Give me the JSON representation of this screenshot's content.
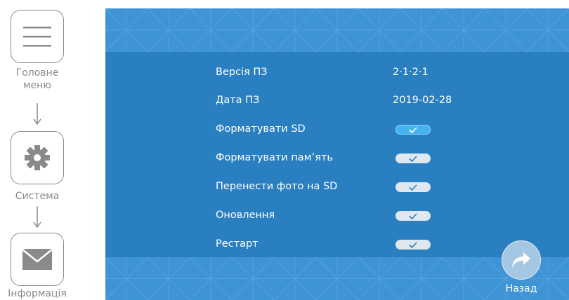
{
  "nav": {
    "items": [
      {
        "label_line1": "Головне",
        "label_line2": "меню",
        "icon": "hamburger-menu-icon"
      },
      {
        "label": "Система",
        "icon": "gear-icon"
      },
      {
        "label": "Інформація",
        "icon": "envelope-icon"
      }
    ]
  },
  "screen": {
    "background_color": "#2a7fc0",
    "band_color": "#3f94d6",
    "rows": [
      {
        "label": "Версія ПЗ",
        "value": "2·1·2·1"
      },
      {
        "label": "Дата ПЗ",
        "value": "2019-02-28"
      },
      {
        "label": "Форматувати SD",
        "button": "check",
        "active": true
      },
      {
        "label": "Форматувати пам’ять",
        "button": "check",
        "active": false
      },
      {
        "label": "Перенести фото на SD",
        "button": "check",
        "active": false
      },
      {
        "label": "Оновлення",
        "button": "check",
        "active": false
      },
      {
        "label": "Рестарт",
        "button": "check",
        "active": false
      }
    ],
    "back": {
      "label": "Назад",
      "icon": "forward-arrow-icon"
    }
  }
}
